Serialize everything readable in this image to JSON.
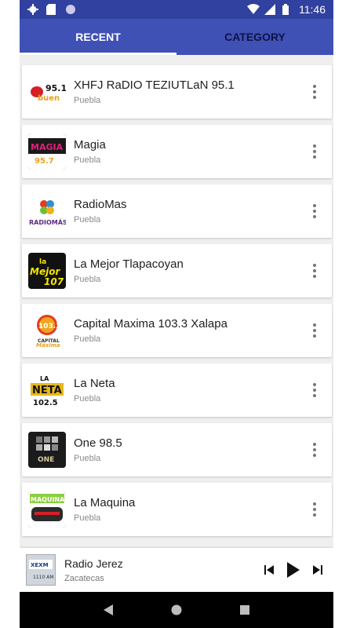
{
  "status": {
    "time": "11:46"
  },
  "tabs": [
    {
      "label": "RECENT",
      "active": true
    },
    {
      "label": "CATEGORY",
      "active": false
    }
  ],
  "stations": [
    {
      "name": "XHFJ RaDIO TEZIUTLaN 95.1",
      "region": "Puebla",
      "logo_text": "95.1",
      "logo_bg": "#ffffff",
      "logo_fg": "#d71f26"
    },
    {
      "name": "Magia",
      "region": "Puebla",
      "logo_text": "MAGIA",
      "logo_bg": "#1a1a1a",
      "logo_fg": "#e21f79"
    },
    {
      "name": "RadioMas",
      "region": "Puebla",
      "logo_text": "RADIOMÁS",
      "logo_bg": "#ffffff",
      "logo_fg": "#5b2a86"
    },
    {
      "name": "La Mejor Tlapacoyan",
      "region": "Puebla",
      "logo_text": "Mejor 107",
      "logo_bg": "#111111",
      "logo_fg": "#f4e600"
    },
    {
      "name": "Capital Maxima 103.3 Xalapa",
      "region": "Puebla",
      "logo_text": "103.3",
      "logo_bg": "#ffffff",
      "logo_fg": "#e53a1e"
    },
    {
      "name": "La Neta",
      "region": "Puebla",
      "logo_text": "NETA",
      "logo_bg": "#ffffff",
      "logo_fg": "#111111"
    },
    {
      "name": "One 98.5",
      "region": "Puebla",
      "logo_text": "ONE",
      "logo_bg": "#1b1b1b",
      "logo_fg": "#d8c9a0"
    },
    {
      "name": "La Maquina",
      "region": "Puebla",
      "logo_text": "MAQUINA",
      "logo_bg": "#1d1d1d",
      "logo_fg": "#8ccf3f"
    }
  ],
  "player": {
    "title": "Radio Jerez",
    "subtitle": "Zacatecas",
    "thumb_text": "XEXM"
  },
  "colors": {
    "statusbar": "#31419f",
    "appbar": "#3f51b5",
    "background": "#efefef"
  }
}
